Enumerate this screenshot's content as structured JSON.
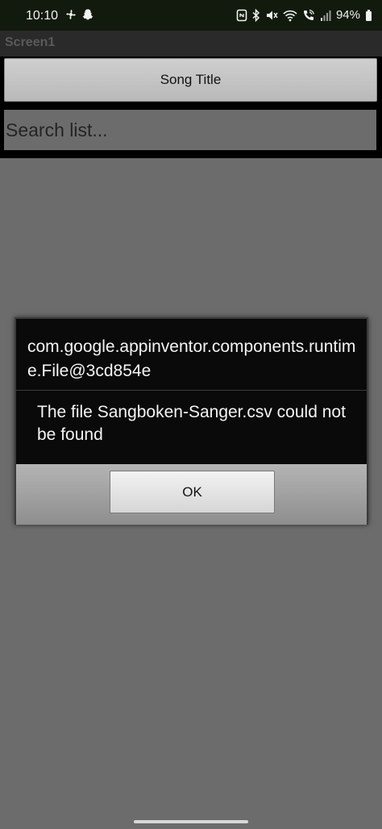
{
  "status_bar": {
    "time": "10:10",
    "battery": "94%",
    "left_icons": [
      "fan-icon",
      "snapchat-icon"
    ],
    "right_icons": [
      "nfc-icon",
      "bluetooth-icon",
      "mute-icon",
      "wifi-icon",
      "wifi-call-icon",
      "signal-icon",
      "battery-icon"
    ]
  },
  "app": {
    "title": "Screen1"
  },
  "main": {
    "song_title_label": "Song Title",
    "search_placeholder": "Search list..."
  },
  "dialog": {
    "title": "com.google.appinventor.components.runtime.File@3cd854e",
    "message": "The file Sangboken-Sanger.csv could not be found",
    "ok_label": "OK"
  },
  "colors": {
    "background": "#6c6c6c",
    "status_bar": "#121a0d",
    "dialog_bg": "#0a0a0a"
  }
}
